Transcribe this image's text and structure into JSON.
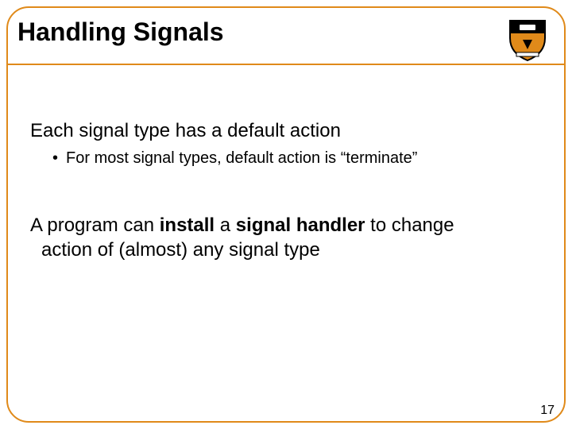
{
  "title": "Handling Signals",
  "body": {
    "p1": "Each signal type has a default action",
    "sub1_bullet": "•",
    "sub1": "For most signal types, default action is “terminate”",
    "p2_pre": "A program can ",
    "p2_b1": "install",
    "p2_mid": " a ",
    "p2_b2": "signal handler",
    "p2_post": " to change",
    "p2_cont": "action of (almost) any signal type"
  },
  "page_number": "17",
  "logo_alt": "princeton-shield"
}
